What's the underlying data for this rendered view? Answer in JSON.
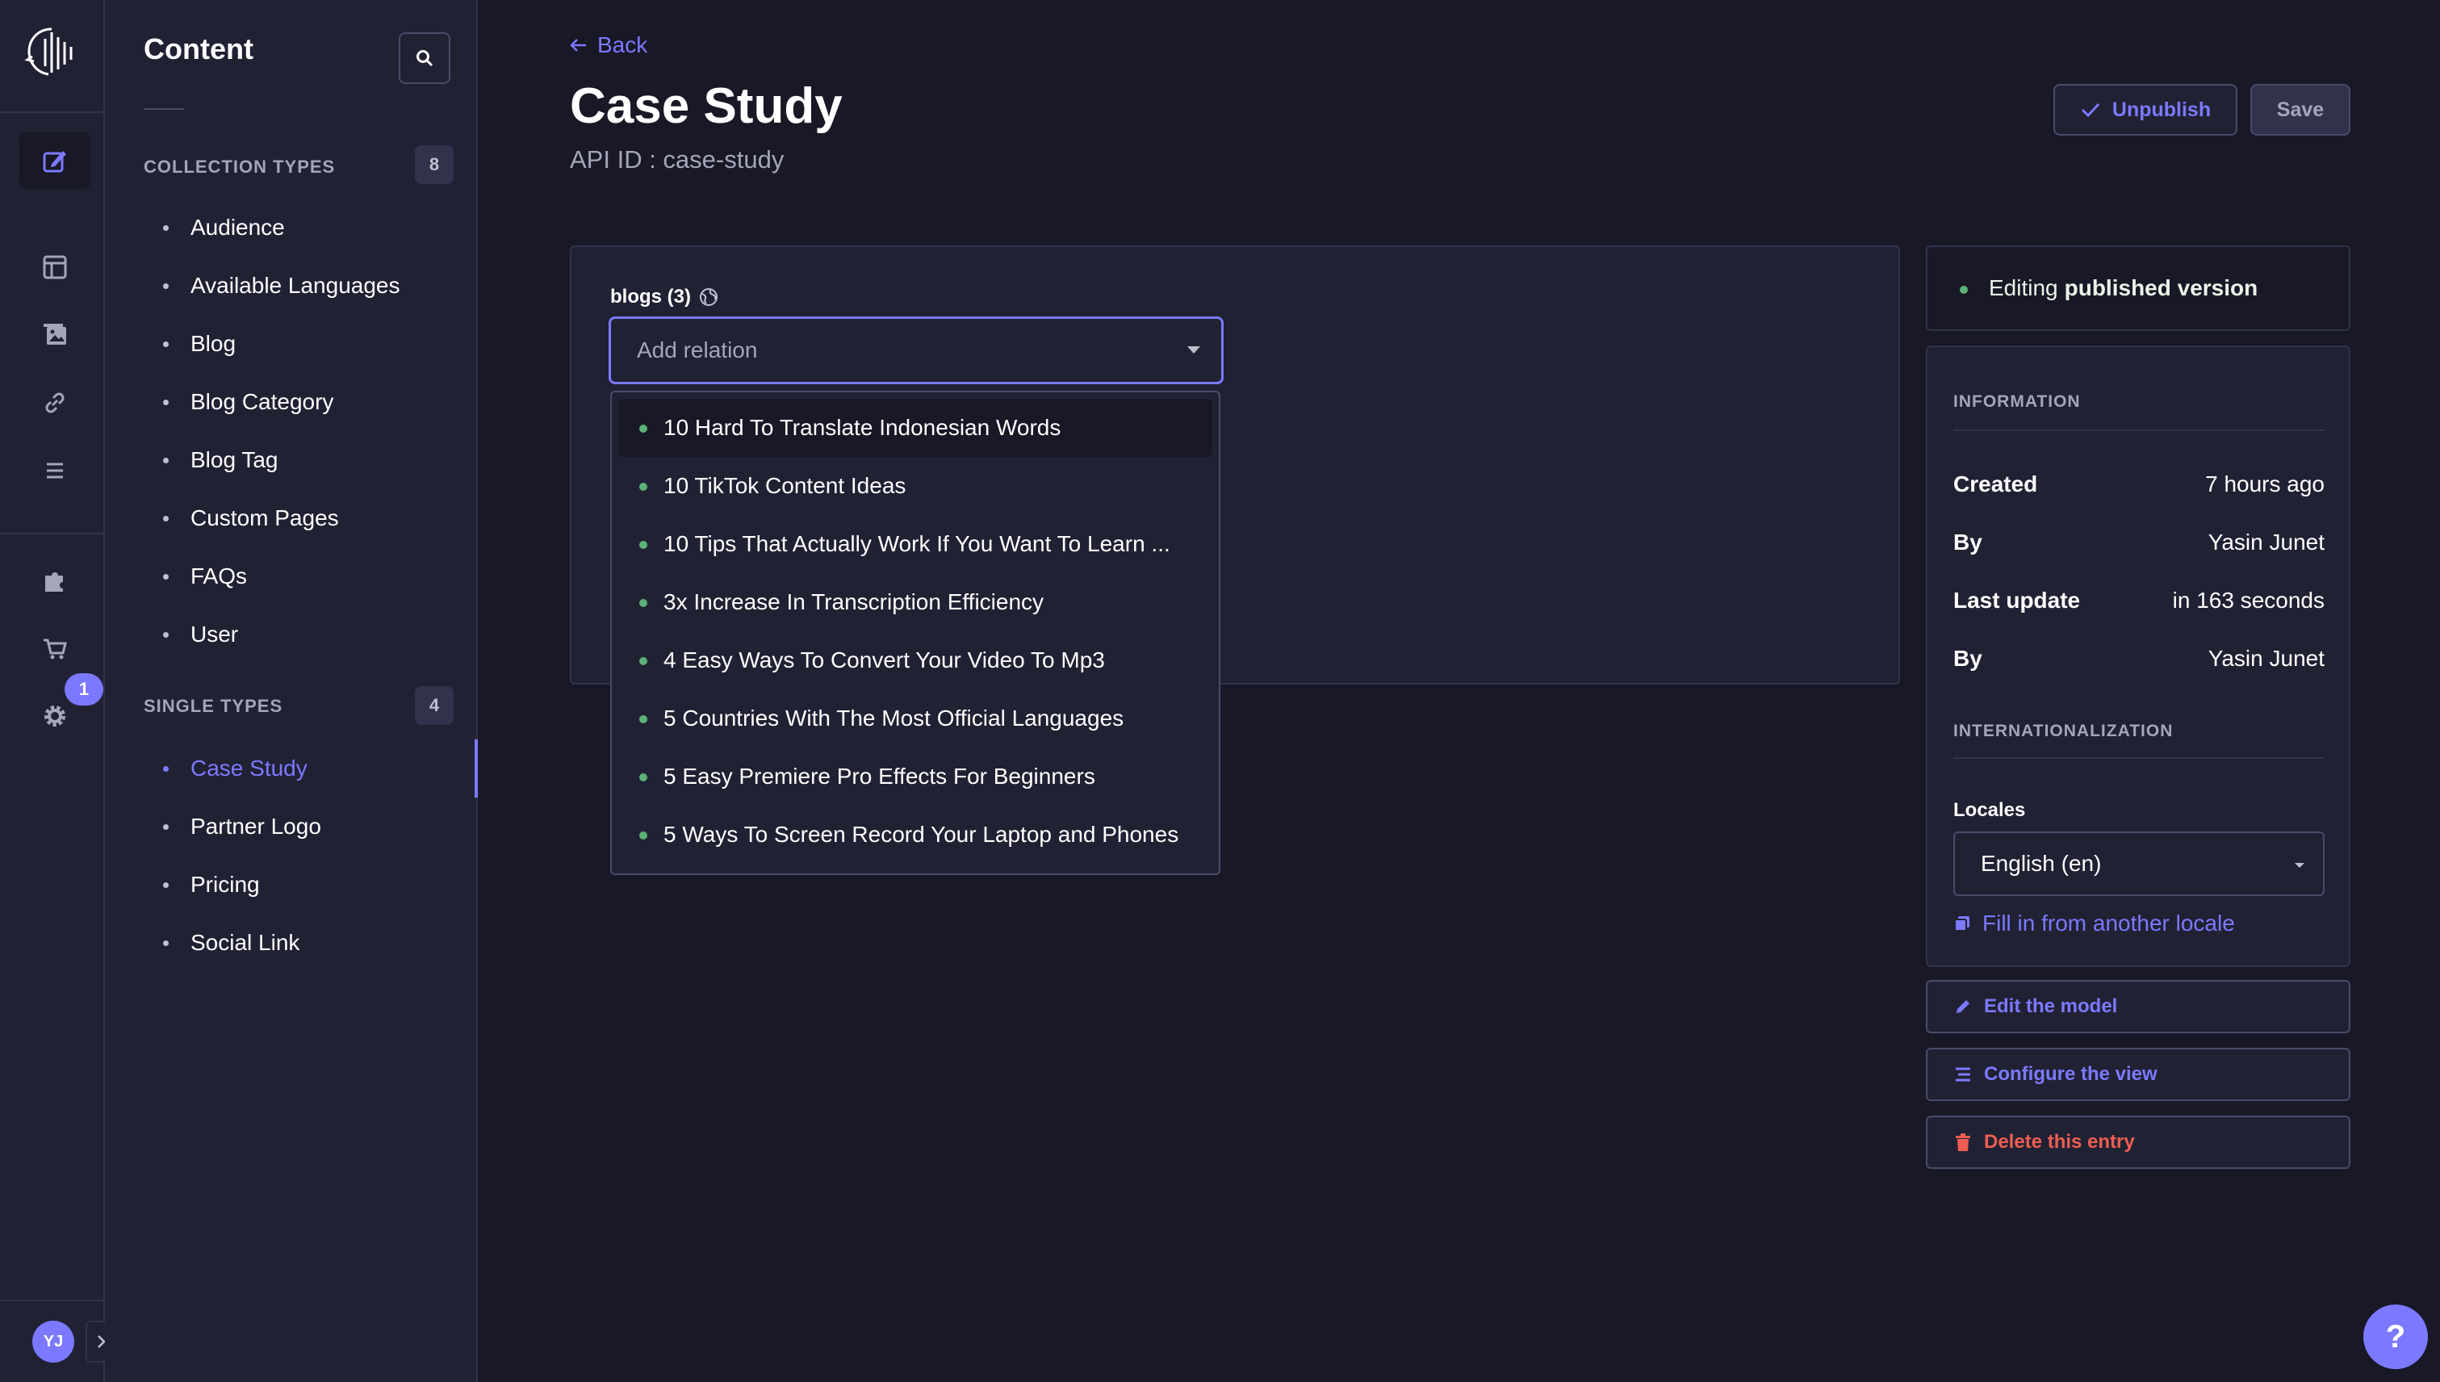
{
  "rail": {
    "notification_count": "1",
    "user_initials": "YJ",
    "icons": [
      "content-manager-icon",
      "content-type-builder-icon",
      "media-library-icon",
      "url-redirects-icon",
      "menus-icon",
      "plugins-icon",
      "marketplace-icon",
      "settings-icon"
    ]
  },
  "sidebar": {
    "title": "Content",
    "collection_types_label": "COLLECTION TYPES",
    "collection_types_count": "8",
    "collection_types": [
      {
        "label": "Audience"
      },
      {
        "label": "Available Languages"
      },
      {
        "label": "Blog"
      },
      {
        "label": "Blog Category"
      },
      {
        "label": "Blog Tag"
      },
      {
        "label": "Custom Pages"
      },
      {
        "label": "FAQs"
      },
      {
        "label": "User"
      }
    ],
    "single_types_label": "SINGLE TYPES",
    "single_types_count": "4",
    "single_types": [
      {
        "label": "Case Study",
        "active": true
      },
      {
        "label": "Partner Logo"
      },
      {
        "label": "Pricing"
      },
      {
        "label": "Social Link"
      }
    ]
  },
  "header": {
    "back_label": "Back",
    "title": "Case Study",
    "api_id": "API ID : case-study",
    "unpublish_label": "Unpublish",
    "save_label": "Save"
  },
  "editor": {
    "field_label": "blogs (3)",
    "relation_placeholder": "Add relation",
    "options": [
      "10 Hard To Translate Indonesian Words",
      "10 TikTok Content Ideas",
      "10 Tips That Actually Work If You Want To Learn ...",
      "3x Increase In Transcription Efficiency",
      "4 Easy Ways To Convert Your Video To Mp3",
      "5 Countries With The Most Official Languages",
      "5 Easy Premiere Pro Effects For Beginners",
      "5 Ways To Screen Record Your Laptop and Phones"
    ]
  },
  "panel": {
    "status_prefix": "Editing",
    "status_emphasis": "published version",
    "information_label": "INFORMATION",
    "rows": [
      {
        "key": "Created",
        "value": "7 hours ago"
      },
      {
        "key": "By",
        "value": "Yasin Junet"
      },
      {
        "key": "Last update",
        "value": "in 163 seconds"
      },
      {
        "key": "By",
        "value": "Yasin Junet"
      }
    ],
    "i18n_label": "INTERNATIONALIZATION",
    "locales_label": "Locales",
    "locale_value": "English (en)",
    "fill_locale_label": "Fill in from another locale",
    "edit_model_label": "Edit the model",
    "configure_view_label": "Configure the view",
    "delete_entry_label": "Delete this entry"
  },
  "help_label": "?",
  "colors": {
    "background": "#181826",
    "surface": "#212134",
    "border": "#32324d",
    "accent": "#7b79ff",
    "success": "#5cb176",
    "danger": "#ee5e52"
  }
}
